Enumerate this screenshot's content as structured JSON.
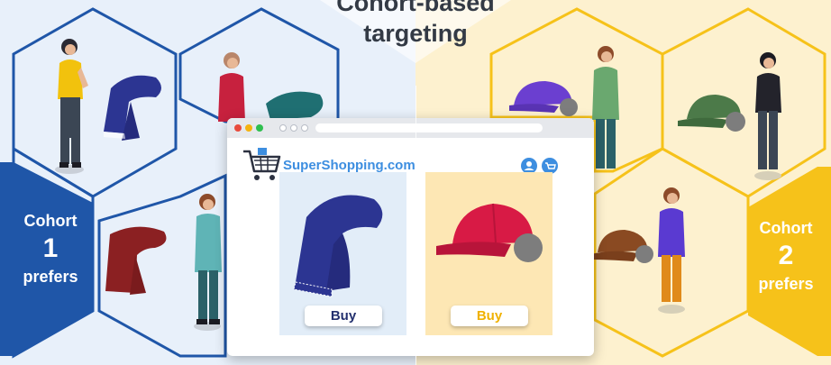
{
  "title": {
    "line1": "Cohort-based",
    "line2": "targeting"
  },
  "cohort1": {
    "label_top": "Cohort",
    "number": "1",
    "label_bottom": "prefers"
  },
  "cohort2": {
    "label_top": "Cohort",
    "number": "2",
    "label_bottom": "prefers"
  },
  "browser": {
    "site_name": "SuperShopping.com",
    "left_product": {
      "buy_label": "Buy"
    },
    "right_product": {
      "buy_label": "Buy"
    }
  },
  "colors": {
    "left_bg": "#e8f0fa",
    "right_bg": "#fdf1cf",
    "blue_line": "#1f56a8",
    "yellow_line": "#f6c21a",
    "cohort1_fill": "#1f56a8",
    "cohort2_fill": "#f6c21a",
    "scarf_blue": "#2c3592",
    "scarf_red": "#8b2022",
    "cap_red": "#d81a45"
  },
  "icons": [
    "cart-icon",
    "user-icon",
    "basket-icon",
    "scarf-icon",
    "cap-icon",
    "person-icon"
  ]
}
